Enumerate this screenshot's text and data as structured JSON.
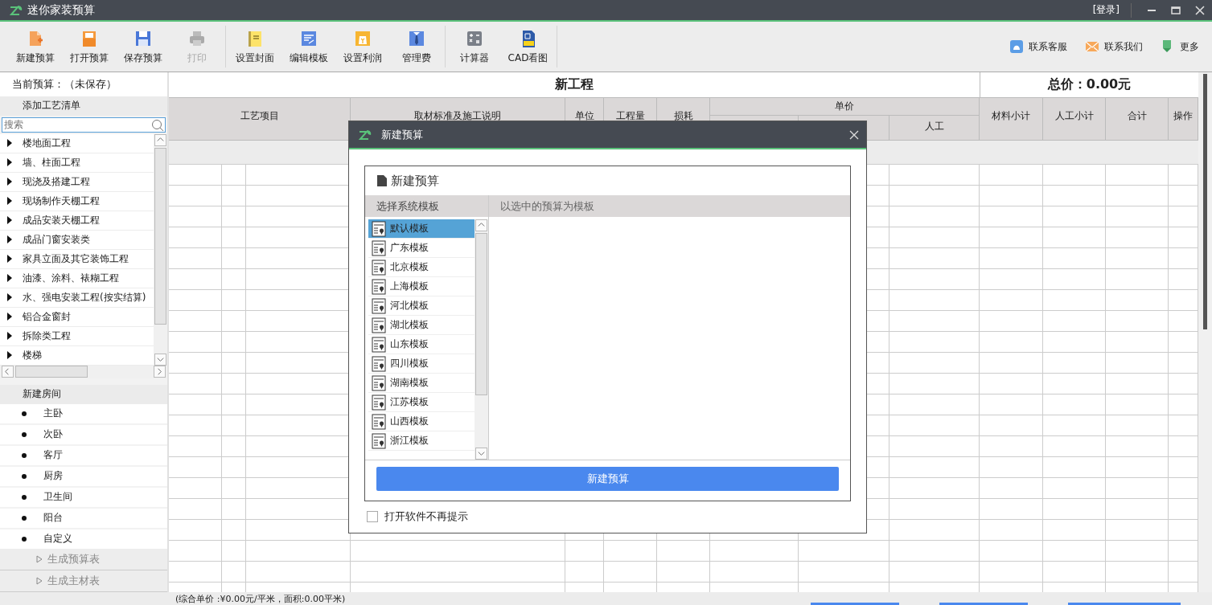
{
  "window": {
    "title": "迷你家装预算",
    "login": "[登录]"
  },
  "toolbar": {
    "groups": [
      {
        "buttons": [
          {
            "label": "新建预算",
            "disabled": false
          },
          {
            "label": "打开预算",
            "disabled": false
          },
          {
            "label": "保存预算",
            "disabled": false
          },
          {
            "label": "打印",
            "disabled": true
          }
        ]
      },
      {
        "buttons": [
          {
            "label": "设置封面",
            "disabled": false
          },
          {
            "label": "编辑模板",
            "disabled": false
          },
          {
            "label": "设置利润",
            "disabled": false
          },
          {
            "label": "管理费",
            "disabled": false
          }
        ]
      },
      {
        "buttons": [
          {
            "label": "计算器",
            "disabled": false
          },
          {
            "label": "CAD看图",
            "disabled": false
          }
        ]
      }
    ],
    "links": [
      {
        "label": "联系客服"
      },
      {
        "label": "联系我们"
      },
      {
        "label": "更多"
      }
    ]
  },
  "sidebar": {
    "current": "当前预算：（未保存）",
    "craft_header": "添加工艺清单",
    "search": {
      "placeholder": "搜索"
    },
    "tree": [
      {
        "label": "楼地面工程",
        "expanded": false
      },
      {
        "label": "墙、柱面工程",
        "expanded": false
      },
      {
        "label": "现浇及搭建工程",
        "expanded": false
      },
      {
        "label": "现场制作天棚工程",
        "expanded": false
      },
      {
        "label": "成品安装天棚工程",
        "expanded": false
      },
      {
        "label": "成品门窗安装类",
        "expanded": false
      },
      {
        "label": "家具立面及其它装饰工程",
        "expanded": false
      },
      {
        "label": "油漆、涂料、裱糊工程",
        "expanded": false
      },
      {
        "label": "水、强电安装工程(按实结算)",
        "expanded": false
      },
      {
        "label": "铝合金窗封",
        "expanded": false
      },
      {
        "label": "拆除类工程",
        "expanded": false
      },
      {
        "label": "楼梯",
        "expanded": false
      }
    ],
    "rooms_header": "新建房间",
    "rooms": [
      "主卧",
      "次卧",
      "客厅",
      "厨房",
      "卫生间",
      "阳台",
      "自定义"
    ],
    "actions": [
      "生成预算表",
      "生成主材表"
    ]
  },
  "table": {
    "title": "新工程",
    "total": "总价：0.00元",
    "columns": [
      {
        "label": "工艺项目"
      },
      {
        "label": "取材标准及施工说明"
      },
      {
        "label": "单位"
      },
      {
        "label": "工程量"
      },
      {
        "label": "损耗"
      },
      {
        "label": "单价",
        "children": [
          "人工"
        ]
      },
      {
        "label": "材料小计"
      },
      {
        "label": "人工小计"
      },
      {
        "label": "合计"
      },
      {
        "label": "操作"
      }
    ]
  },
  "status_bar": {
    "text": "(综合单价 :¥0.00元/平米，面积:0.00平米)"
  },
  "dialog": {
    "title": "新建预算",
    "heading": "新建预算",
    "tabs": [
      {
        "label": "选择系统模板",
        "selected": true
      },
      {
        "label": "以选中的预算为模板",
        "selected": false
      }
    ],
    "templates": [
      {
        "label": "默认模板",
        "selected": true
      },
      {
        "label": "广东模板",
        "selected": false
      },
      {
        "label": "北京模板",
        "selected": false
      },
      {
        "label": "上海模板",
        "selected": false
      },
      {
        "label": "河北模板",
        "selected": false
      },
      {
        "label": "湖北模板",
        "selected": false
      },
      {
        "label": "山东模板",
        "selected": false
      },
      {
        "label": "四川模板",
        "selected": false
      },
      {
        "label": "湖南模板",
        "selected": false
      },
      {
        "label": "江苏模板",
        "selected": false
      },
      {
        "label": "山西模板",
        "selected": false
      },
      {
        "label": "浙江模板",
        "selected": false
      }
    ],
    "create_button": "新建预算",
    "dont_show": {
      "label": "打开软件不再提示",
      "checked": false
    }
  }
}
